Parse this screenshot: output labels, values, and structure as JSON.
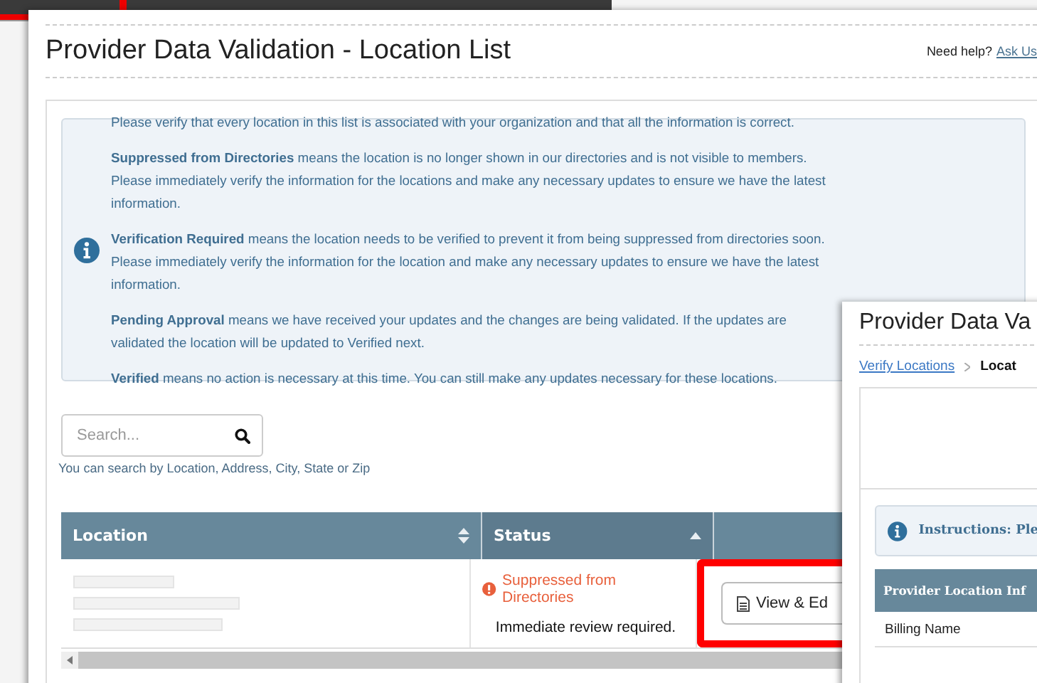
{
  "main_window": {
    "title": "Provider Data Validation - Location List",
    "help_text": "Need help?",
    "help_link": "Ask Us",
    "info": [
      "Please verify that every location in this list is associated with your organization and that all the information is correct.",
      "**Suppressed from Directories** means the location is no longer shown in our directories and is not visible to members.   Please immediately verify the information for the locations and make any necessary updates to ensure we have the latest information.",
      "**Verification Required** means the location needs to be verified to prevent it from being suppressed from directories soon.  Please immediately verify the information for the location and make any necessary updates to ensure we have the latest information.",
      "**Pending Approval** means we have received your updates and the changes are being validated.  If the updates are validated the location will be updated to Verified next.",
      "**Verified** means no action is necessary at this time.  You can still make any updates necessary for these locations."
    ],
    "search": {
      "placeholder": "Search...",
      "hint": "You can search by Location, Address, City, State or Zip"
    },
    "table": {
      "columns": [
        {
          "label": "Location",
          "sorted": false
        },
        {
          "label": "Status",
          "sorted": true
        }
      ],
      "rows": [
        {
          "status": "Suppressed from Directories",
          "note": "Immediate review required.",
          "action": "View & Ed",
          "highlighted": true
        }
      ]
    }
  },
  "detail_window": {
    "title": "Provider Data Va",
    "breadcrumb": [
      {
        "label": "Verify Locations",
        "kind": "link"
      },
      {
        "label": "Locat",
        "kind": "current"
      }
    ],
    "instructions": "Instructions: Ple",
    "table_header": "Provider Location Inf",
    "rows": [
      "Billing Name"
    ]
  }
}
